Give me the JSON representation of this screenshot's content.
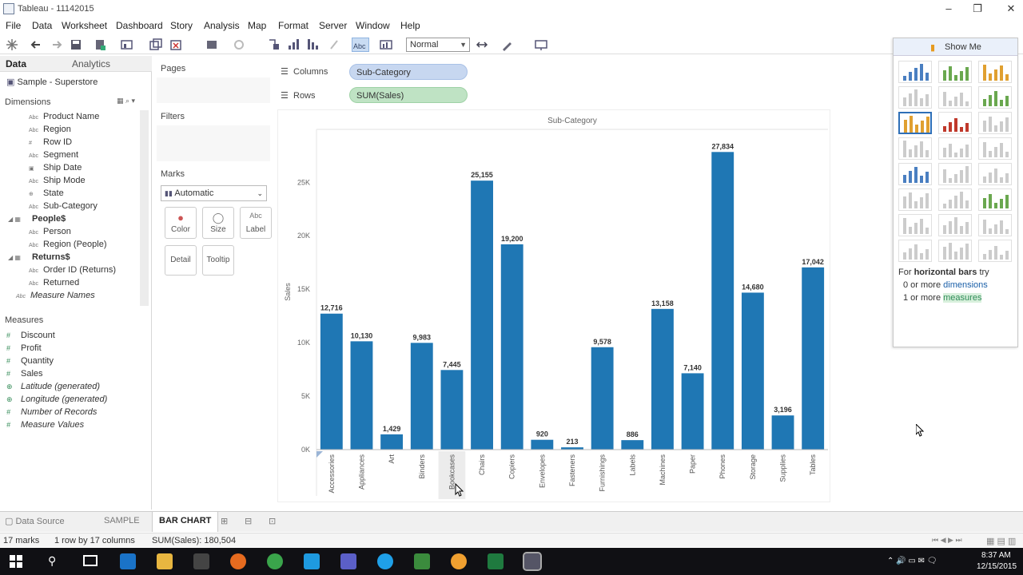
{
  "window": {
    "title": "Tableau - 11142015"
  },
  "menu": [
    "File",
    "Data",
    "Worksheet",
    "Dashboard",
    "Story",
    "Analysis",
    "Map",
    "Format",
    "Server",
    "Window",
    "Help"
  ],
  "toolbar": {
    "fit_select": "Normal"
  },
  "left_pane": {
    "tabs": [
      "Data",
      "Analytics"
    ],
    "datasource": "Sample - Superstore",
    "dimensions_header": "Dimensions",
    "dimensions": [
      {
        "type": "Abc",
        "label": "Product Name"
      },
      {
        "type": "Abc",
        "label": "Region"
      },
      {
        "type": "#",
        "label": "Row ID"
      },
      {
        "type": "Abc",
        "label": "Segment"
      },
      {
        "type": "cal",
        "label": "Ship Date"
      },
      {
        "type": "Abc",
        "label": "Ship Mode"
      },
      {
        "type": "geo",
        "label": "State"
      },
      {
        "type": "Abc",
        "label": "Sub-Category"
      },
      {
        "type": "table",
        "label": "People$"
      },
      {
        "type": "Abc",
        "label": "Person"
      },
      {
        "type": "Abc",
        "label": "Region (People)"
      },
      {
        "type": "table",
        "label": "Returns$"
      },
      {
        "type": "Abc",
        "label": "Order ID (Returns)"
      },
      {
        "type": "Abc",
        "label": "Returned"
      },
      {
        "type": "Abc",
        "label": "Measure Names"
      }
    ],
    "measures_header": "Measures",
    "measures": [
      "Discount",
      "Profit",
      "Quantity",
      "Sales",
      "Latitude (generated)",
      "Longitude (generated)",
      "Number of Records",
      "Measure Values"
    ]
  },
  "cards": {
    "pages": "Pages",
    "filters": "Filters",
    "marks": "Marks",
    "mark_type": "Automatic",
    "mark_buttons": [
      "Color",
      "Size",
      "Label",
      "Detail",
      "Tooltip"
    ]
  },
  "shelves": {
    "columns_label": "Columns",
    "columns_pill": "Sub-Category",
    "rows_label": "Rows",
    "rows_pill": "SUM(Sales)"
  },
  "chart_data": {
    "type": "bar",
    "title": "Sub-Category",
    "ylabel": "Sales",
    "categories": [
      "Accessories",
      "Appliances",
      "Art",
      "Binders",
      "Bookcases",
      "Chairs",
      "Copiers",
      "Envelopes",
      "Fasteners",
      "Furnishings",
      "Labels",
      "Machines",
      "Paper",
      "Phones",
      "Storage",
      "Supplies",
      "Tables"
    ],
    "values": [
      12716,
      10130,
      1429,
      9983,
      7445,
      25155,
      19200,
      920,
      213,
      9578,
      886,
      13158,
      7140,
      27834,
      14680,
      3196,
      17042
    ],
    "value_labels": [
      "12,716",
      "10,130",
      "1,429",
      "9,983",
      "7,445",
      "25,155",
      "19,200",
      "920",
      "213",
      "9,578",
      "886",
      "13,158",
      "7,140",
      "27,834",
      "14,680",
      "3,196",
      "17,042"
    ],
    "y_ticks": [
      0,
      5000,
      10000,
      15000,
      20000,
      25000
    ],
    "y_tick_labels": [
      "0K",
      "5K",
      "10K",
      "15K",
      "20K",
      "25K"
    ],
    "ylim": [
      0,
      29500
    ],
    "color": "#1f77b4"
  },
  "show_me": {
    "title": "Show Me",
    "hint_prefix": "For ",
    "hint_bold": "horizontal bars",
    "hint_suffix": " try",
    "line2_prefix": "0 or more ",
    "line2_link": "dimensions",
    "line3_prefix": "1 or more ",
    "line3_link": "measures"
  },
  "bottom_tabs": [
    "Data Source",
    "SAMPLE",
    "BAR CHART"
  ],
  "status": {
    "marks": "17 marks",
    "rows_cols": "1 row by 17 columns",
    "sum": "SUM(Sales): 180,504"
  },
  "clock": {
    "time": "8:37 AM",
    "date": "12/15/2015"
  }
}
